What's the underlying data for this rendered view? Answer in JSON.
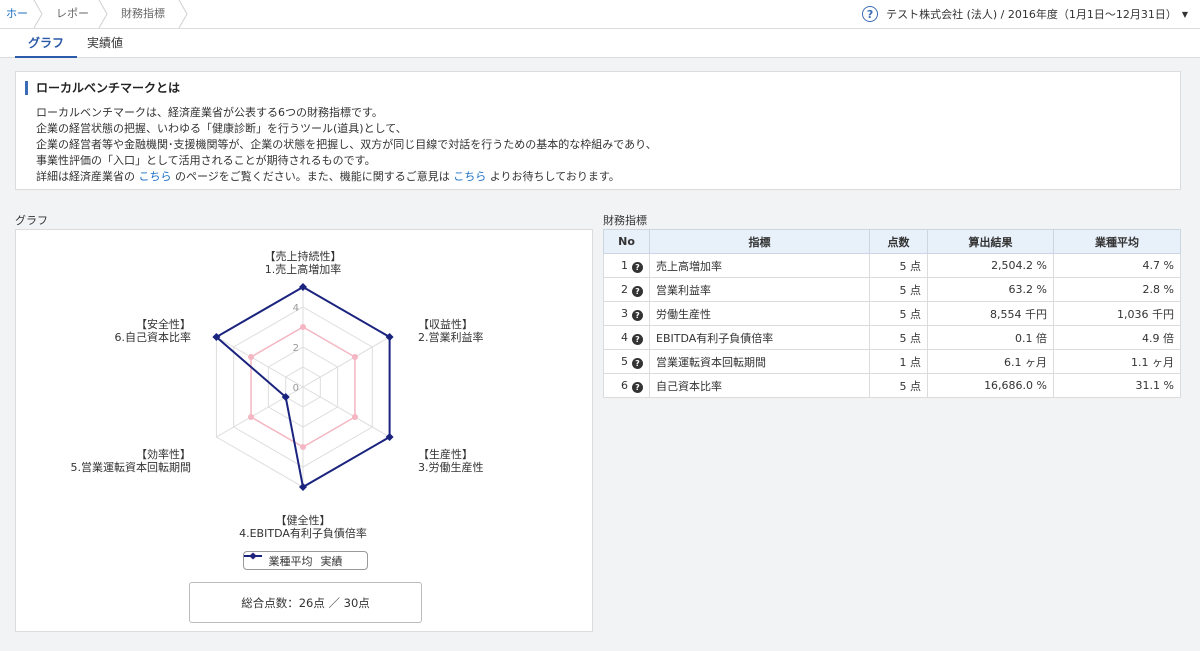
{
  "breadcrumb": [
    "ホーム",
    "レポート",
    "財務指標(β)"
  ],
  "company": {
    "help_icon": "help-circle-icon",
    "label": "テスト株式会社 (法人) / 2016年度（1月1日〜12月31日）"
  },
  "tabs": [
    {
      "label": "グラフ",
      "active": true
    },
    {
      "label": "実績値",
      "active": false
    }
  ],
  "info": {
    "title": "ローカルベンチマークとは",
    "line1": "ローカルベンチマークは、経済産業省が公表する6つの財務指標です。",
    "line2": "企業の経営状態の把握、いわゆる「健康診断」を行うツール(道具)として、",
    "line3": "企業の経営者等や金融機関･支援機関等が、企業の状態を把握し、双方が同じ目線で対話を行うための基本的な枠組みであり、",
    "line4": "事業性評価の「入口」として活用されることが期待されるものです。",
    "line5_a": "詳細は経済産業省の ",
    "line5_link1": "こちら",
    "line5_b": " のページをご覧ください。また、機能に関するご意見は ",
    "line5_link2": "こちら",
    "line5_c": " よりお待ちしております。"
  },
  "graph_label": "グラフ",
  "table_label": "財務指標",
  "chart_data": {
    "type": "radar",
    "axes": [
      {
        "cat": "【売上持続性】",
        "name": "1.売上高増加率"
      },
      {
        "cat": "【収益性】",
        "name": "2.営業利益率"
      },
      {
        "cat": "【生産性】",
        "name": "3.労働生産性"
      },
      {
        "cat": "【健全性】",
        "name": "4.EBITDA有利子負債倍率"
      },
      {
        "cat": "【効率性】",
        "name": "5.営業運転資本回転期間"
      },
      {
        "cat": "【安全性】",
        "name": "6.自己資本比率"
      }
    ],
    "ticks": [
      "0",
      "2",
      "4"
    ],
    "range": [
      0,
      5
    ],
    "series": [
      {
        "name": "業種平均",
        "color": "#f4b6c2",
        "values": [
          3,
          3,
          3,
          3,
          3,
          3
        ]
      },
      {
        "name": "実績",
        "color": "#1a237e",
        "values": [
          5,
          5,
          5,
          5,
          1,
          5
        ]
      }
    ]
  },
  "total_score": "総合点数：26点 ／ 30点",
  "table": {
    "headers": [
      "No",
      "指標",
      "点数",
      "算出結果",
      "業種平均"
    ],
    "rows": [
      {
        "no": "1",
        "name": "売上高増加率",
        "score": "5 点",
        "result": "2,504.2 %",
        "avg": "4.7 %"
      },
      {
        "no": "2",
        "name": "営業利益率",
        "score": "5 点",
        "result": "63.2 %",
        "avg": "2.8 %"
      },
      {
        "no": "3",
        "name": "労働生産性",
        "score": "5 点",
        "result": "8,554 千円",
        "avg": "1,036 千円"
      },
      {
        "no": "4",
        "name": "EBITDA有利子負債倍率",
        "score": "5 点",
        "result": "0.1 倍",
        "avg": "4.9 倍"
      },
      {
        "no": "5",
        "name": "営業運転資本回転期間",
        "score": "1 点",
        "result": "6.1 ヶ月",
        "avg": "1.1 ヶ月"
      },
      {
        "no": "6",
        "name": "自己資本比率",
        "score": "5 点",
        "result": "16,686.0 %",
        "avg": "31.1 %"
      }
    ]
  }
}
